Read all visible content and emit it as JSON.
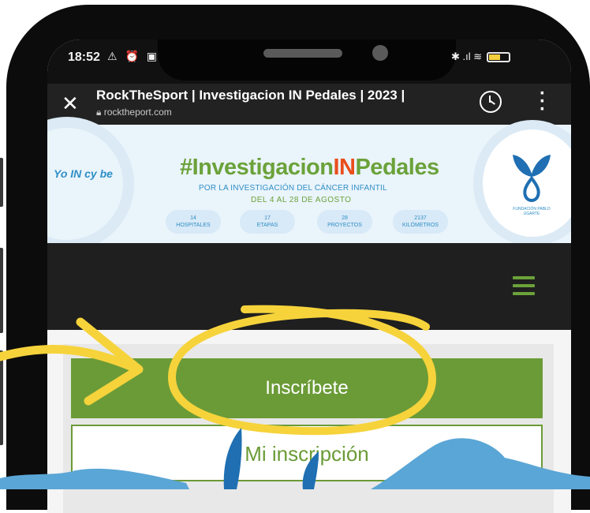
{
  "status_bar": {
    "time": "18:52",
    "left_icons": "⚠ ⏰ ▣",
    "right_icons": "✱ .ıl ≋"
  },
  "browser": {
    "tab_title": "RockTheSport | Investigacion IN Pedales | 2023 |",
    "url": "rocktheport.com"
  },
  "banner": {
    "logo_left_text": "Yo IN cy be",
    "hashtag_prefix": "#Investigacion",
    "hashtag_in": "IN",
    "hashtag_suffix": "Pedales",
    "subtitle": "POR LA INVESTIGACIÓN DEL CÁNCER INFANTIL",
    "dates": "DEL 4 AL 28 DE AGOSTO",
    "pills": [
      {
        "num": "14",
        "label": "HOSPITALES"
      },
      {
        "num": "17",
        "label": "ETAPAS"
      },
      {
        "num": "28",
        "label": "PROYECTOS"
      },
      {
        "num": "2137",
        "label": "KILÓMETROS"
      }
    ],
    "org_caption": "FUNDACIÓN PABLO UGARTE"
  },
  "actions": {
    "inscribe_label": "Inscríbete",
    "my_inscription_label": "Mi inscripción"
  },
  "colors": {
    "accent_green": "#6b9b37",
    "highlight_yellow": "#f6d33b",
    "brand_blue": "#1f6fb2"
  },
  "icons": {
    "close": "close-icon",
    "history": "history-icon",
    "menu": "hamburger-menu-icon",
    "overflow": "kebab-menu-icon"
  }
}
